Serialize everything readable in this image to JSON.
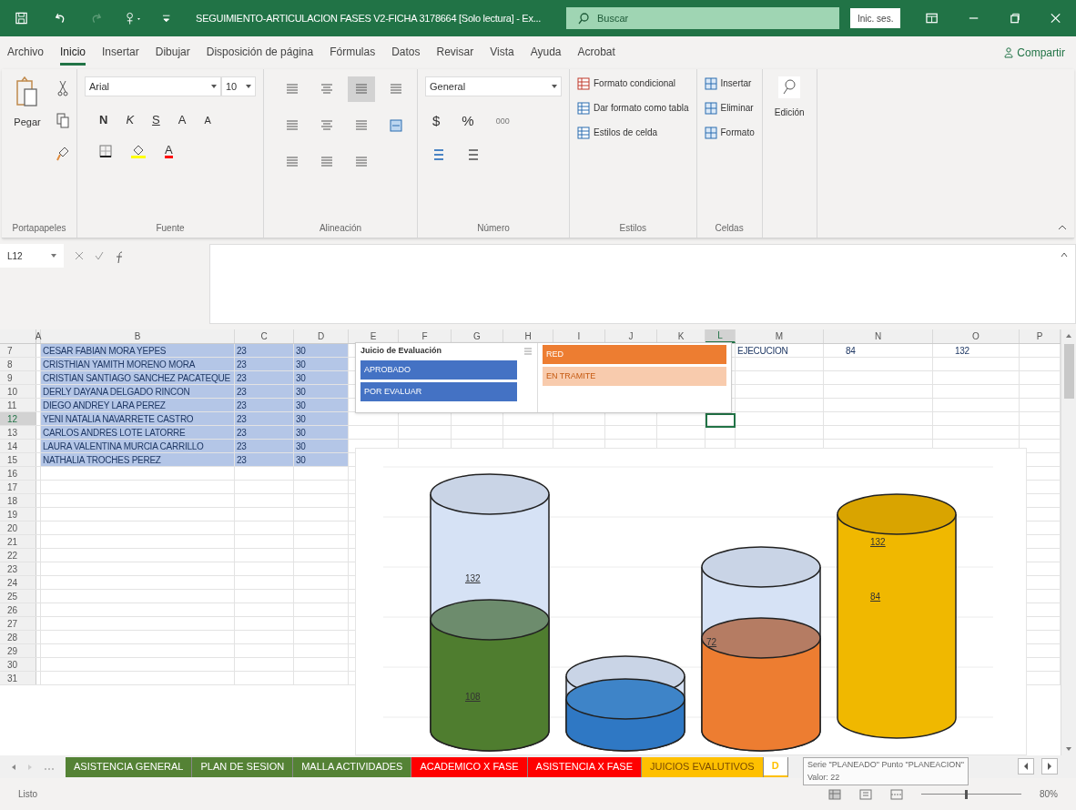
{
  "title_bar": {
    "title": "SEGUIMIENTO-ARTICULACION FASES V2-FICHA 3178664 [Solo lectura] - Ex...",
    "search_placeholder": "Buscar",
    "sign_in": "Inic. ses."
  },
  "menu_tabs": [
    {
      "label": "Archivo",
      "selected": false
    },
    {
      "label": "Inicio",
      "selected": true
    },
    {
      "label": "Insertar",
      "selected": false
    },
    {
      "label": "Dibujar",
      "selected": false
    },
    {
      "label": "Disposición de página",
      "selected": false
    },
    {
      "label": "Fórmulas",
      "selected": false
    },
    {
      "label": "Datos",
      "selected": false
    },
    {
      "label": "Revisar",
      "selected": false
    },
    {
      "label": "Vista",
      "selected": false
    },
    {
      "label": "Ayuda",
      "selected": false
    },
    {
      "label": "Acrobat",
      "selected": false
    }
  ],
  "share": "Compartir",
  "ribbon": {
    "paste": "Pegar",
    "font_name": "Arial",
    "font_size": "10",
    "bold": "N",
    "italic": "K",
    "underline": "S",
    "grow_font": "A",
    "shrink_font": "A",
    "font_color": "A",
    "number_format": "General",
    "currency": "$",
    "percent": "%",
    "thousands": "000",
    "styles": [
      "Formato condicional",
      "Dar formato como tabla",
      "Estilos de celda"
    ],
    "cells": [
      "Insertar",
      "Eliminar",
      "Formato"
    ],
    "editing": "Edición",
    "groups": [
      "Portapapeles",
      "Fuente",
      "Alineación",
      "Número",
      "Estilos",
      "Celdas"
    ]
  },
  "formula_bar": {
    "name_box": "L12"
  },
  "columns": [
    {
      "label": "A",
      "selected": false
    },
    {
      "label": "B",
      "selected": false
    },
    {
      "label": "C",
      "selected": false
    },
    {
      "label": "D",
      "selected": false
    },
    {
      "label": "E",
      "selected": false
    },
    {
      "label": "F",
      "selected": false
    },
    {
      "label": "G",
      "selected": false
    },
    {
      "label": "H",
      "selected": false
    },
    {
      "label": "I",
      "selected": false
    },
    {
      "label": "J",
      "selected": false
    },
    {
      "label": "K",
      "selected": false
    },
    {
      "label": "L",
      "selected": true
    },
    {
      "label": "M",
      "selected": false
    },
    {
      "label": "N",
      "selected": false
    },
    {
      "label": "O",
      "selected": false
    },
    {
      "label": "P",
      "selected": false
    }
  ],
  "rows": [
    {
      "row": "7",
      "selected": false,
      "B": "CESAR FABIAN MORA YEPES",
      "C": "23",
      "D": "30",
      "M": "EJECUCION",
      "N": "84",
      "O": "132"
    },
    {
      "row": "8",
      "selected": false,
      "B": "CRISTHIAN YAMITH MORENO MORA",
      "C": "23",
      "D": "30"
    },
    {
      "row": "9",
      "selected": false,
      "B": "CRISTIAN SANTIAGO SANCHEZ PACATEQUE",
      "C": "23",
      "D": "30"
    },
    {
      "row": "10",
      "selected": false,
      "B": "DERLY DAYANA DELGADO RINCON",
      "C": "23",
      "D": "30"
    },
    {
      "row": "11",
      "selected": false,
      "B": "DIEGO ANDREY LARA PEREZ",
      "C": "23",
      "D": "30"
    },
    {
      "row": "12",
      "selected": true,
      "B": "YENI NATALIA NAVARRETE CASTRO",
      "C": "23",
      "D": "30"
    },
    {
      "row": "13",
      "selected": false,
      "B": "CARLOS ANDRES LOTE LATORRE",
      "C": "23",
      "D": "30"
    },
    {
      "row": "14",
      "selected": false,
      "B": "LAURA VALENTINA MURCIA CARRILLO",
      "C": "23",
      "D": "30"
    },
    {
      "row": "15",
      "selected": false,
      "B": "NATHALIA TROCHES PEREZ",
      "C": "23",
      "D": "30"
    },
    {
      "row": "16",
      "selected": false
    },
    {
      "row": "17",
      "selected": false
    },
    {
      "row": "18",
      "selected": false
    },
    {
      "row": "19",
      "selected": false
    },
    {
      "row": "20",
      "selected": false
    },
    {
      "row": "21",
      "selected": false
    },
    {
      "row": "22",
      "selected": false
    },
    {
      "row": "23",
      "selected": false
    },
    {
      "row": "24",
      "selected": false
    },
    {
      "row": "25",
      "selected": false
    },
    {
      "row": "26",
      "selected": false
    },
    {
      "row": "27",
      "selected": false
    },
    {
      "row": "28",
      "selected": false
    },
    {
      "row": "29",
      "selected": false
    },
    {
      "row": "30",
      "selected": false
    },
    {
      "row": "31",
      "selected": false
    }
  ],
  "slicers": [
    {
      "title": "Juicio de Evaluación",
      "items": [
        {
          "label": "APROBADO",
          "selected": true
        },
        {
          "label": "POR EVALUAR",
          "selected": true
        }
      ]
    },
    {
      "items": [
        {
          "label": "RED",
          "selected": true
        },
        {
          "label": "EN TRAMITE",
          "selected": false
        }
      ]
    }
  ],
  "chart": {
    "labels": [
      "132",
      "108",
      "72",
      "132",
      "84"
    ]
  },
  "sheet_tabs": [
    {
      "label": "ASISTENCIA GENERAL",
      "color": "#548235",
      "selected": false
    },
    {
      "label": "PLAN DE SESION",
      "color": "#548235",
      "selected": false
    },
    {
      "label": "MALLA ACTIVIDADES",
      "color": "#548235",
      "selected": false
    },
    {
      "label": "ACADEMICO X FASE",
      "color": "#ff0000",
      "selected": false
    },
    {
      "label": "ASISTENCIA X FASE",
      "color": "#ff0000",
      "selected": false
    },
    {
      "label": "JUICIOS EVALUTIVOS",
      "color": "#ffc000",
      "selected": false
    },
    {
      "label": "D",
      "color": "#ffc000",
      "selected": true
    }
  ],
  "tooltip": {
    "lines": [
      "Serie \"PLANEADO\" Punto \"PLANEACION\"",
      "Valor: 22"
    ]
  },
  "status_bar": {
    "status": "Listo",
    "zoom_slider": {
      "level": 0.45
    },
    "zoom": "80%"
  }
}
